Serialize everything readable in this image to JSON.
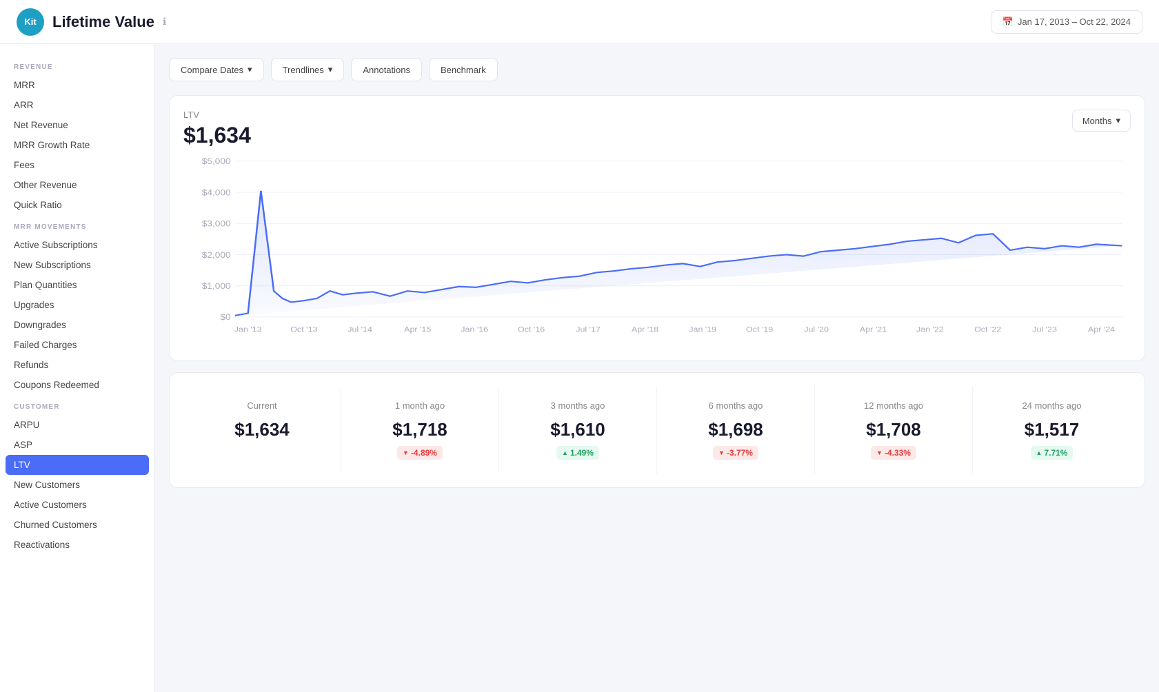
{
  "header": {
    "logo_text": "Kit",
    "title": "Lifetime Value",
    "info_icon": "ℹ",
    "date_range": "Jan 17, 2013  –  Oct 22, 2024",
    "calendar_icon": "📅"
  },
  "sidebar": {
    "sections": [
      {
        "label": "REVENUE",
        "items": [
          {
            "id": "mrr",
            "label": "MRR",
            "active": false
          },
          {
            "id": "arr",
            "label": "ARR",
            "active": false
          },
          {
            "id": "net-revenue",
            "label": "Net Revenue",
            "active": false
          },
          {
            "id": "mrr-growth-rate",
            "label": "MRR Growth Rate",
            "active": false
          },
          {
            "id": "fees",
            "label": "Fees",
            "active": false
          },
          {
            "id": "other-revenue",
            "label": "Other Revenue",
            "active": false
          },
          {
            "id": "quick-ratio",
            "label": "Quick Ratio",
            "active": false
          }
        ]
      },
      {
        "label": "MRR MOVEMENTS",
        "items": [
          {
            "id": "active-subscriptions",
            "label": "Active Subscriptions",
            "active": false
          },
          {
            "id": "new-subscriptions",
            "label": "New Subscriptions",
            "active": false
          },
          {
            "id": "plan-quantities",
            "label": "Plan Quantities",
            "active": false
          },
          {
            "id": "upgrades",
            "label": "Upgrades",
            "active": false
          },
          {
            "id": "downgrades",
            "label": "Downgrades",
            "active": false
          },
          {
            "id": "failed-charges",
            "label": "Failed Charges",
            "active": false
          },
          {
            "id": "refunds",
            "label": "Refunds",
            "active": false
          },
          {
            "id": "coupons-redeemed",
            "label": "Coupons Redeemed",
            "active": false
          }
        ]
      },
      {
        "label": "CUSTOMER",
        "items": [
          {
            "id": "arpu",
            "label": "ARPU",
            "active": false
          },
          {
            "id": "asp",
            "label": "ASP",
            "active": false
          },
          {
            "id": "ltv",
            "label": "LTV",
            "active": true
          },
          {
            "id": "new-customers",
            "label": "New Customers",
            "active": false
          },
          {
            "id": "active-customers",
            "label": "Active Customers",
            "active": false
          },
          {
            "id": "churned-customers",
            "label": "Churned Customers",
            "active": false
          },
          {
            "id": "reactivations",
            "label": "Reactivations",
            "active": false
          }
        ]
      }
    ]
  },
  "toolbar": {
    "compare_dates_label": "Compare Dates",
    "trendlines_label": "Trendlines",
    "annotations_label": "Annotations",
    "benchmark_label": "Benchmark",
    "chevron": "▾"
  },
  "chart": {
    "label": "LTV",
    "value": "$1,634",
    "period_label": "Months",
    "x_labels": [
      "Jan '13",
      "Oct '13",
      "Jul '14",
      "Apr '15",
      "Jan '16",
      "Oct '16",
      "Jul '17",
      "Apr '18",
      "Jan '19",
      "Oct '19",
      "Jul '20",
      "Apr '21",
      "Jan '22",
      "Oct '22",
      "Jul '23",
      "Apr '24"
    ],
    "y_labels": [
      "$5,000",
      "$4,000",
      "$3,000",
      "$2,000",
      "$1,000",
      "$0"
    ]
  },
  "comparison": {
    "columns": [
      {
        "period": "Current",
        "value": "$1,634",
        "badge": null
      },
      {
        "period": "1 month ago",
        "value": "$1,718",
        "badge": {
          "text": "-4.89%",
          "type": "down"
        }
      },
      {
        "period": "3 months ago",
        "value": "$1,610",
        "badge": {
          "text": "1.49%",
          "type": "up"
        }
      },
      {
        "period": "6 months ago",
        "value": "$1,698",
        "badge": {
          "text": "-3.77%",
          "type": "down"
        }
      },
      {
        "period": "12 months ago",
        "value": "$1,708",
        "badge": {
          "text": "-4.33%",
          "type": "down"
        }
      },
      {
        "period": "24 months ago",
        "value": "$1,517",
        "badge": {
          "text": "7.71%",
          "type": "up"
        }
      }
    ]
  }
}
